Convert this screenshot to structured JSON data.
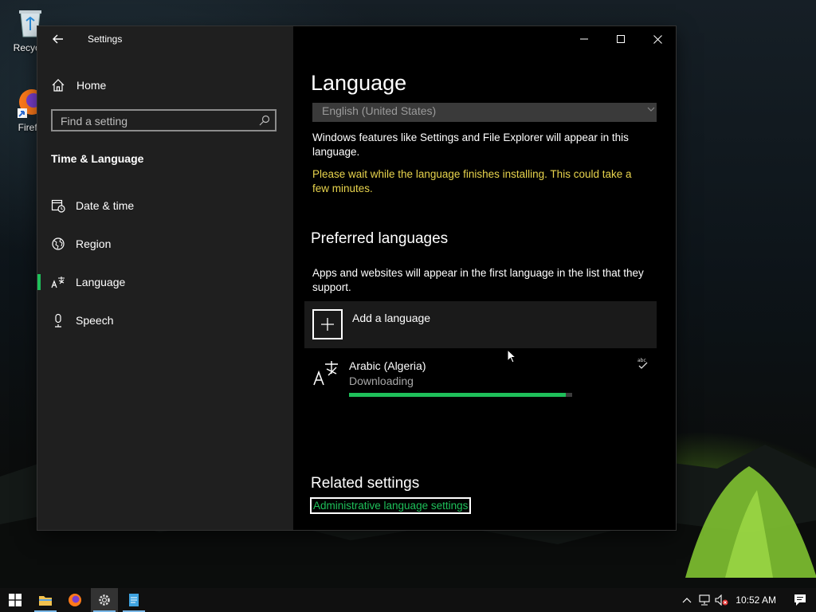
{
  "desktop": {
    "icons": [
      {
        "label": "Recycle",
        "icon": "recycle-bin-icon"
      },
      {
        "label": "Firefo",
        "icon": "firefox-icon"
      }
    ]
  },
  "window": {
    "title": "Settings",
    "controls": [
      "minimize-icon",
      "maximize-icon",
      "close-icon"
    ]
  },
  "nav": {
    "home_label": "Home",
    "search_placeholder": "Find a setting",
    "section_title": "Time & Language",
    "items": [
      {
        "label": "Date & time",
        "icon": "calendar-clock-icon",
        "active": false
      },
      {
        "label": "Region",
        "icon": "globe-icon",
        "active": false
      },
      {
        "label": "Language",
        "icon": "language-icon",
        "active": true
      },
      {
        "label": "Speech",
        "icon": "microphone-icon",
        "active": false
      }
    ],
    "accent": "#1ec05a"
  },
  "content": {
    "title": "Language",
    "display_language": "English (United States)",
    "display_desc": "Windows features like Settings and File Explorer will appear in this language.",
    "install_warning": "Please wait while the language finishes installing. This could take a few minutes.",
    "preferred_title": "Preferred languages",
    "preferred_desc": "Apps and websites will appear in the first language in the list that they support.",
    "add_language_label": "Add a language",
    "languages": [
      {
        "name": "Arabic (Algeria)",
        "status": "Downloading",
        "progress": 0.97
      }
    ],
    "related_title": "Related settings",
    "related_link": "Administrative language settings"
  },
  "taskbar": {
    "apps": [
      "file-explorer-icon",
      "firefox-icon",
      "settings-gear-icon",
      "notepad-icon"
    ],
    "clock": "10:52 AM"
  }
}
